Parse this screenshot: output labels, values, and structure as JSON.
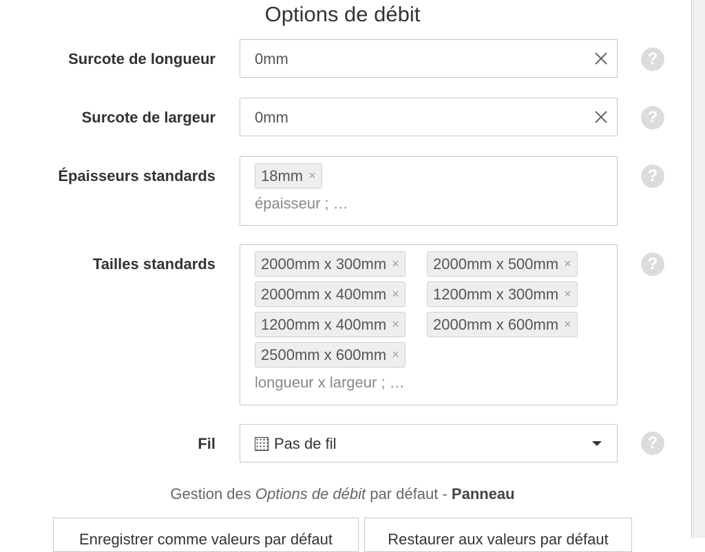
{
  "title": "Options de débit",
  "length_margin": {
    "label": "Surcote de longueur",
    "value": "0mm"
  },
  "width_margin": {
    "label": "Surcote de largeur",
    "value": "0mm"
  },
  "thicknesses": {
    "label": "Épaisseurs standards",
    "tags": [
      "18mm"
    ],
    "placeholder": "épaisseur ; …"
  },
  "sizes": {
    "label": "Tailles standards",
    "tags": [
      "2000mm x 300mm",
      "2000mm x 500mm",
      "2000mm x 400mm",
      "1200mm x 300mm",
      "1200mm x 400mm",
      "2000mm x 600mm",
      "2500mm x 600mm"
    ],
    "placeholder": "longueur x largeur ; …"
  },
  "grain": {
    "label": "Fil",
    "value": "Pas de fil"
  },
  "manage": {
    "prefix": "Gestion des",
    "emphasis": "Options de débit",
    "middle": "par défaut -",
    "bold": "Panneau"
  },
  "buttons": {
    "save": "Enregistrer comme valeurs par défaut",
    "restore": "Restaurer aux valeurs par défaut"
  },
  "icons": {
    "help": "?",
    "tag_remove": "×"
  }
}
